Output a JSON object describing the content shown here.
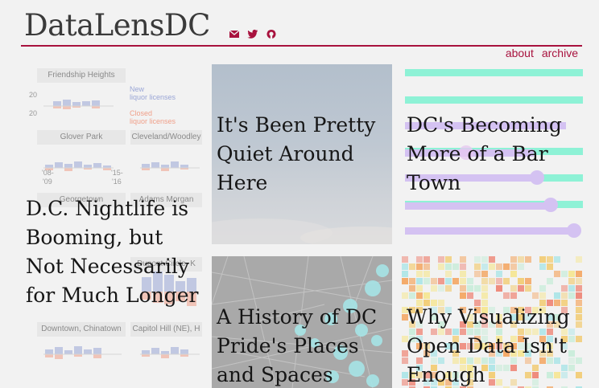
{
  "header": {
    "site_title": "DataLensDC",
    "social_icons": [
      "envelope-icon",
      "twitter-icon",
      "github-icon"
    ],
    "accent_color": "#a8123e"
  },
  "nav": {
    "about": "about",
    "archive": "archive"
  },
  "tiles": [
    {
      "title": "D.C. Nightlife is Booming, but Not Necessarily for Much Longer",
      "neighborhoods": [
        "Friendship Heights",
        "Glover Park",
        "Cleveland/Woodley",
        "Georgetown",
        "Adams Morgan",
        "Dupont Circle, K",
        "Downtown, Chinatown",
        "Capitol Hill (NE), H"
      ],
      "legend_new": "New",
      "legend_new_2": "liquor licenses",
      "legend_closed": "Closed",
      "legend_closed_2": "liquor licenses",
      "tick_20a": "20",
      "tick_20b": "20",
      "tick_08": "'08-",
      "tick_09": "'09",
      "tick_15": "'15-",
      "tick_16": "'16"
    },
    {
      "title": "It's Been Pretty Quiet Around Here"
    },
    {
      "title": "DC's Becoming More of a Bar Town"
    },
    {
      "title": "A History of DC Pride's Places and Spaces"
    },
    {
      "title": "Why Visualizing Open Data Isn't Enough"
    }
  ]
}
